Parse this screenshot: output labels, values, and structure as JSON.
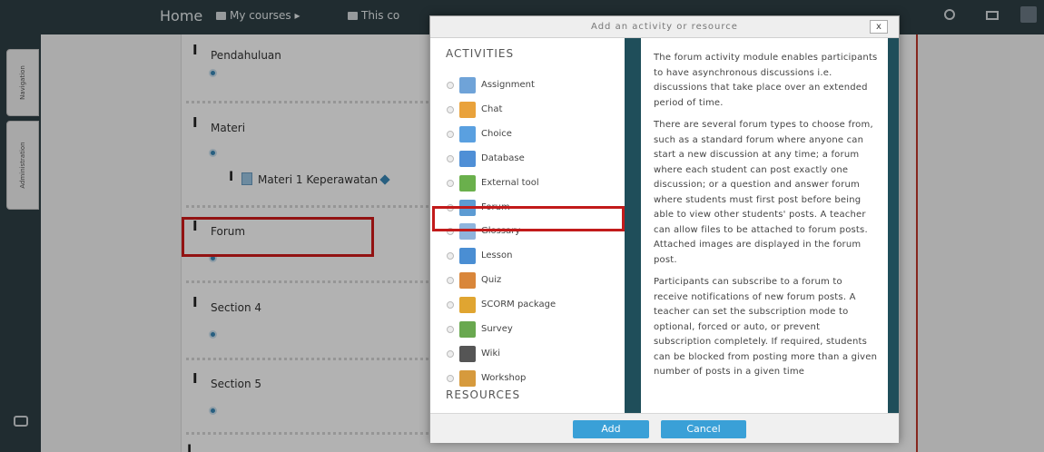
{
  "navbar": {
    "home": "Home",
    "my_courses": "My courses ▸",
    "this_course": "This co"
  },
  "rail": {
    "tab_navigation": "Navigation",
    "tab_administration": "Administration"
  },
  "course": {
    "sections": [
      "Pendahuluan",
      "Materi",
      "Forum",
      "Section 4",
      "Section 5"
    ],
    "materi_item": "Materi 1 Keperawatan"
  },
  "modal": {
    "title": "Add an activity or resource",
    "close_label": "x",
    "activities_heading": "ACTIVITIES",
    "resources_heading": "RESOURCES",
    "activities": [
      {
        "label": "Assignment",
        "icon": "assignment-icon",
        "color": "#6fa3d8"
      },
      {
        "label": "Chat",
        "icon": "chat-icon",
        "color": "#e9a23b"
      },
      {
        "label": "Choice",
        "icon": "choice-icon",
        "color": "#5aa0e0"
      },
      {
        "label": "Database",
        "icon": "database-icon",
        "color": "#4f8fd6"
      },
      {
        "label": "External tool",
        "icon": "puzzle-icon",
        "color": "#6ab04c"
      },
      {
        "label": "Forum",
        "icon": "forum-icon",
        "color": "#5c9bd3"
      },
      {
        "label": "Glossary",
        "icon": "glossary-icon",
        "color": "#8fb4dd"
      },
      {
        "label": "Lesson",
        "icon": "lesson-icon",
        "color": "#4a8ed3"
      },
      {
        "label": "Quiz",
        "icon": "quiz-icon",
        "color": "#d9863a"
      },
      {
        "label": "SCORM package",
        "icon": "scorm-icon",
        "color": "#e0a531"
      },
      {
        "label": "Survey",
        "icon": "survey-icon",
        "color": "#69a84f"
      },
      {
        "label": "Wiki",
        "icon": "wiki-icon",
        "color": "#555555"
      },
      {
        "label": "Workshop",
        "icon": "workshop-icon",
        "color": "#d69a3d"
      }
    ],
    "description": [
      "The forum activity module enables participants to have asynchronous discussions i.e. discussions that take place over an extended period of time.",
      "There are several forum types to choose from, such as a standard forum where anyone can start a new discussion at any time; a forum where each student can post exactly one discussion; or a question and answer forum where students must first post before being able to view other students' posts. A teacher can allow files to be attached to forum posts. Attached images are displayed in the forum post.",
      "Participants can subscribe to a forum to receive notifications of new forum posts. A teacher can set the subscription mode to optional, forced or auto, or prevent subscription completely. If required, students can be blocked from posting more than a given number of posts in a given time"
    ],
    "add_label": "Add",
    "cancel_label": "Cancel"
  },
  "colors": {
    "navbar_bg": "#2f3f45",
    "highlight_red": "#d11a1a",
    "button_blue": "#3aa0d7",
    "desc_frame": "#1f4e5a"
  }
}
